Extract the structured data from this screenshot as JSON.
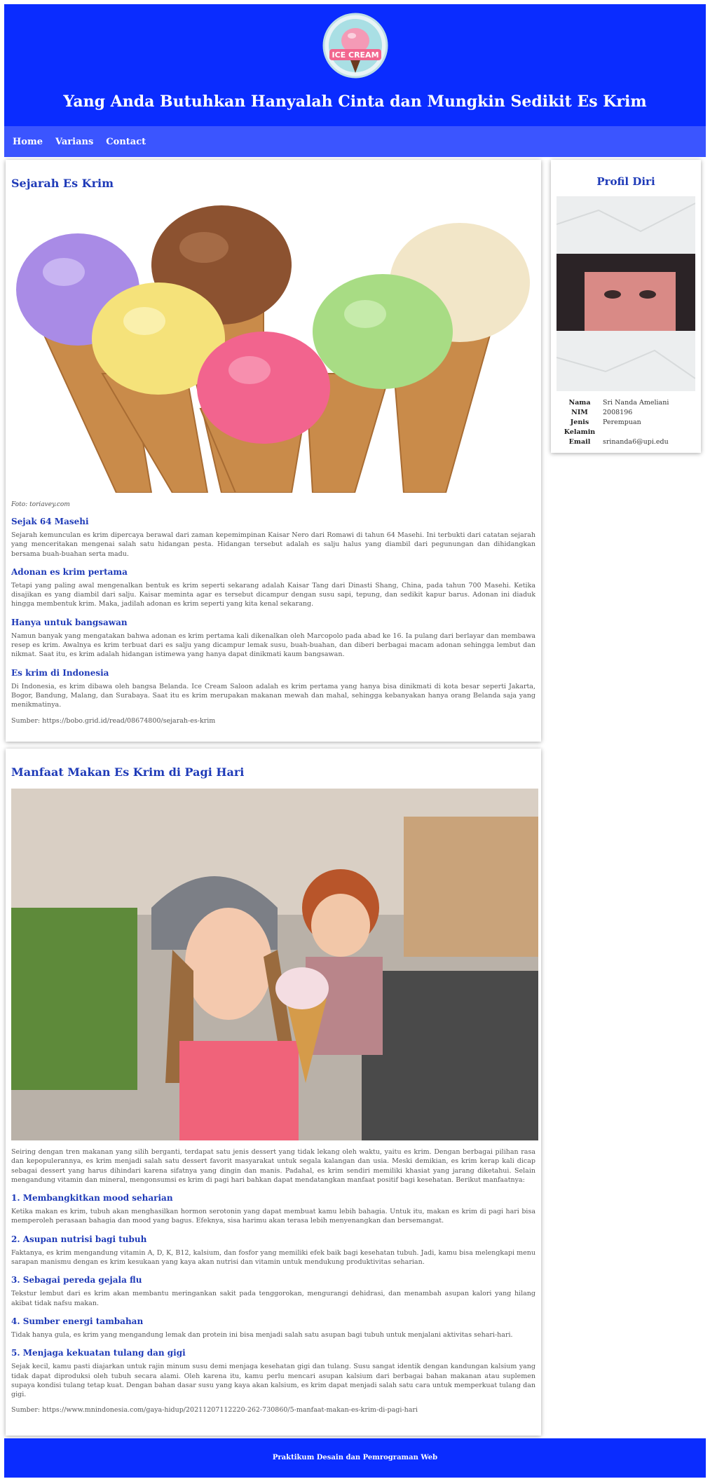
{
  "header": {
    "logo_text": "ICE CREAM",
    "title": "Yang Anda Butuhkan Hanyalah Cinta dan Mungkin Sedikit Es Krim"
  },
  "nav": {
    "home": "Home",
    "varians": "Varians",
    "contact": "Contact"
  },
  "article1": {
    "title": "Sejarah Es Krim",
    "caption": "Foto: toriavey.com",
    "sections": [
      {
        "heading": "Sejak 64 Masehi",
        "text": "Sejarah kemunculan es krim dipercaya berawal dari zaman kepemimpinan Kaisar Nero dari Romawi di tahun 64 Masehi. Ini terbukti dari catatan sejarah yang menceritakan mengenai salah satu hidangan pesta. Hidangan tersebut adalah es salju halus yang diambil dari pegunungan dan dihidangkan bersama buah-buahan serta madu."
      },
      {
        "heading": "Adonan es krim pertama",
        "text": "Tetapi yang paling awal mengenalkan bentuk es krim seperti sekarang adalah Kaisar Tang dari Dinasti Shang, China, pada tahun 700 Masehi. Ketika disajikan es yang diambil dari salju. Kaisar meminta agar es tersebut dicampur dengan susu sapi, tepung, dan sedikit kapur barus. Adonan ini diaduk hingga membentuk krim. Maka, jadilah adonan es krim seperti yang kita kenal sekarang."
      },
      {
        "heading": "Hanya untuk bangsawan",
        "text": "Namun banyak yang mengatakan bahwa adonan es krim pertama kali dikenalkan oleh Marcopolo pada abad ke 16. Ia pulang dari berlayar dan membawa resep es krim. Awalnya es krim terbuat dari es salju yang dicampur lemak susu, buah-buahan, dan diberi berbagai macam adonan sehingga lembut dan nikmat. Saat itu, es krim adalah hidangan istimewa yang hanya dapat dinikmati kaum bangsawan."
      },
      {
        "heading": "Es krim di Indonesia",
        "text": "Di Indonesia, es krim dibawa oleh bangsa Belanda. Ice Cream Saloon adalah es krim pertama yang hanya bisa dinikmati di kota besar seperti Jakarta, Bogor, Bandung, Malang, dan Surabaya. Saat itu es krim merupakan makanan mewah dan mahal, sehingga kebanyakan hanya orang Belanda saja yang menikmatinya."
      }
    ],
    "source": "Sumber: https://bobo.grid.id/read/08674800/sejarah-es-krim"
  },
  "article2": {
    "title": "Manfaat Makan Es Krim di Pagi Hari",
    "intro": "Seiring dengan tren makanan yang silih berganti, terdapat satu jenis dessert yang tidak lekang oleh waktu, yaitu es krim. Dengan berbagai pilihan rasa dan kepopulerannya, es krim menjadi salah satu dessert favorit masyarakat untuk segala kalangan dan usia. Meski demikian, es krim kerap kali dicap sebagai dessert yang harus dihindari karena sifatnya yang dingin dan manis. Padahal, es krim sendiri memiliki khasiat yang jarang diketahui. Selain mengandung vitamin dan mineral, mengonsumsi es krim di pagi hari bahkan dapat mendatangkan manfaat positif bagi kesehatan. Berikut manfaatnya:",
    "sections": [
      {
        "heading": "1. Membangkitkan mood seharian",
        "text": "Ketika makan es krim, tubuh akan menghasilkan hormon serotonin yang dapat membuat kamu lebih bahagia. Untuk itu, makan es krim di pagi hari bisa memperoleh perasaan bahagia dan mood yang bagus. Efeknya, sisa harimu akan terasa lebih menyenangkan dan bersemangat."
      },
      {
        "heading": "2. Asupan nutrisi bagi tubuh",
        "text": "Faktanya, es krim mengandung vitamin A, D, K, B12, kalsium, dan fosfor yang memiliki efek baik bagi kesehatan tubuh. Jadi, kamu bisa melengkapi menu sarapan manismu dengan es krim kesukaan yang kaya akan nutrisi dan vitamin untuk mendukung produktivitas seharian."
      },
      {
        "heading": "3. Sebagai pereda gejala flu",
        "text": "Tekstur lembut dari es krim akan membantu meringankan sakit pada tenggorokan, mengurangi dehidrasi, dan menambah asupan kalori yang hilang akibat tidak nafsu makan."
      },
      {
        "heading": "4. Sumber energi tambahan",
        "text": "Tidak hanya gula, es krim yang mengandung lemak dan protein ini bisa menjadi salah satu asupan bagi tubuh untuk menjalani aktivitas sehari-hari."
      },
      {
        "heading": "5. Menjaga kekuatan tulang dan gigi",
        "text": "Sejak kecil, kamu pasti diajarkan untuk rajin minum susu demi menjaga kesehatan gigi dan tulang. Susu sangat identik dengan kandungan kalsium yang tidak dapat diproduksi oleh tubuh secara alami. Oleh karena itu, kamu perlu mencari asupan kalsium dari berbagai bahan makanan atau suplemen supaya kondisi tulang tetap kuat. Dengan bahan dasar susu yang kaya akan kalsium, es krim dapat menjadi salah satu cara untuk memperkuat tulang dan gigi."
      }
    ],
    "source": "Sumber: https://www.mnindonesia.com/gaya-hidup/20211207112220-262-730860/5-manfaat-makan-es-krim-di-pagi-hari"
  },
  "profile": {
    "title": "Profil Diri",
    "rows": [
      {
        "key": "Nama",
        "value": "Sri Nanda Ameliani"
      },
      {
        "key": "NIM",
        "value": "2008196"
      },
      {
        "key": "Jenis Kelamin",
        "value": "Perempuan"
      },
      {
        "key": "Email",
        "value": "srinanda6@upi.edu"
      }
    ]
  },
  "footer": {
    "text": "Praktikum Desain dan Pemrograman Web"
  }
}
